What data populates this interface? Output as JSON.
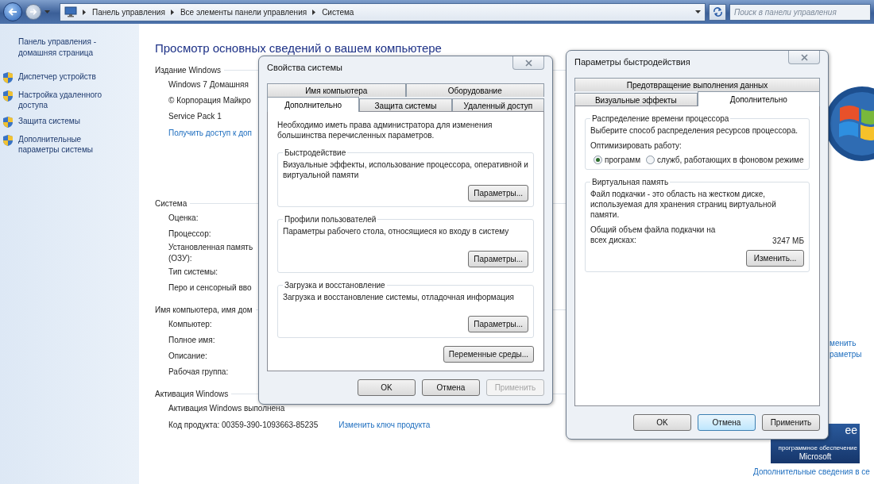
{
  "address_bar": {
    "breadcrumbs": [
      "Панель управления",
      "Все элементы панели управления",
      "Система"
    ],
    "search": {
      "placeholder": "Поиск в панели управления"
    }
  },
  "sidebar": {
    "home_link": "Панель управления - домашняя страница",
    "items": [
      {
        "label": "Диспетчер устройств"
      },
      {
        "label": "Настройка удаленного доступа"
      },
      {
        "label": "Защита системы"
      },
      {
        "label": "Дополнительные параметры системы"
      }
    ]
  },
  "main": {
    "title": "Просмотр основных сведений о вашем компьютере",
    "sections": [
      {
        "heading": "Издание Windows",
        "rows": [
          {
            "label": "Windows 7 Домашняя",
            "kind": "text"
          },
          {
            "label": "© Корпорация Майкро",
            "kind": "text"
          },
          {
            "label": "Service Pack 1",
            "kind": "text"
          },
          {
            "label": "Получить доступ к доп",
            "kind": "link"
          }
        ]
      },
      {
        "heading": "Система",
        "rows": [
          {
            "label": "Оценка:",
            "kind": "text"
          },
          {
            "label": "Процессор:",
            "kind": "text"
          },
          {
            "label": "Установленная память (ОЗУ):",
            "kind": "text"
          },
          {
            "label": "Тип системы:",
            "kind": "text"
          },
          {
            "label": "Перо и сенсорный вво",
            "kind": "text"
          }
        ]
      },
      {
        "heading": "Имя компьютера, имя дом",
        "rows": [
          {
            "label": "Компьютер:",
            "kind": "text"
          },
          {
            "label": "Полное имя:",
            "kind": "text"
          },
          {
            "label": "Описание:",
            "kind": "text"
          },
          {
            "label": "Рабочая группа:",
            "kind": "text"
          }
        ]
      },
      {
        "heading": "Активация Windows",
        "rows": [
          {
            "label": "Активация Windows выполнена",
            "kind": "text"
          },
          {
            "label": "Код продукта: 00359-390-1093663-85235",
            "kind": "text",
            "link": "Изменить ключ продукта"
          }
        ]
      }
    ],
    "side_link_lines": [
      "менить",
      "раметры"
    ],
    "badge": {
      "title": "ee",
      "subtitle": "программное обеспечение",
      "brand": "Microsoft"
    },
    "footer_link": "Дополнительные сведения в се"
  },
  "dialogs": [
    {
      "title": "Свойства системы",
      "tab_rows": [
        [
          {
            "label": "Имя компьютера",
            "selected": false
          },
          {
            "label": "Оборудование",
            "selected": false
          }
        ],
        [
          {
            "label": "Дополнительно",
            "selected": true
          },
          {
            "label": "Защита системы",
            "selected": false
          },
          {
            "label": "Удаленный доступ",
            "selected": false
          }
        ]
      ],
      "content": [
        {
          "kind": "note",
          "text": "Необходимо иметь права администратора для изменения большинства перечисленных параметров."
        },
        {
          "kind": "group",
          "title": "Быстродействие",
          "items": [
            {
              "kind": "text",
              "text": "Визуальные эффекты, использование процессора, оперативной и виртуальной памяти"
            },
            {
              "kind": "button",
              "label": "Параметры..."
            }
          ]
        },
        {
          "kind": "group",
          "title": "Профили пользователей",
          "items": [
            {
              "kind": "text",
              "text": "Параметры рабочего стола, относящиеся ко входу в систему"
            },
            {
              "kind": "button",
              "label": "Параметры..."
            }
          ]
        },
        {
          "kind": "group",
          "title": "Загрузка и восстановление",
          "items": [
            {
              "kind": "text",
              "text": "Загрузка и восстановление системы, отладочная информация"
            },
            {
              "kind": "button",
              "label": "Параметры..."
            }
          ]
        },
        {
          "kind": "button",
          "label": "Переменные среды..."
        }
      ],
      "buttons": [
        {
          "label": "OK",
          "disabled": false,
          "highlighted": false
        },
        {
          "label": "Отмена",
          "disabled": false,
          "highlighted": false
        },
        {
          "label": "Применить",
          "disabled": true,
          "highlighted": false
        }
      ]
    },
    {
      "title": "Параметры быстродействия",
      "tab_rows": [
        [
          {
            "label": "Предотвращение выполнения данных",
            "selected": false
          }
        ],
        [
          {
            "label": "Визуальные эффекты",
            "selected": false
          },
          {
            "label": "Дополнительно",
            "selected": true
          }
        ]
      ],
      "content": [
        {
          "kind": "group",
          "title": "Распределение времени процессора",
          "items": [
            {
              "kind": "text",
              "text": "Выберите способ распределения ресурсов процессора."
            },
            {
              "kind": "text",
              "text": "Оптимизировать работу:"
            },
            {
              "kind": "radios",
              "options": [
                {
                  "label": "программ",
                  "selected": true
                },
                {
                  "label": "служб, работающих в фоновом режиме",
                  "selected": false
                }
              ]
            }
          ]
        },
        {
          "kind": "group",
          "title": "Виртуальная память",
          "items": [
            {
              "kind": "text",
              "text": "Файл подкачки - это область на жестком диске, используемая для хранения страниц виртуальной памяти."
            },
            {
              "kind": "value",
              "label": "Общий объем файла подкачки на всех дисках:",
              "value": "3247 МБ"
            },
            {
              "kind": "button",
              "label": "Изменить..."
            }
          ]
        }
      ],
      "buttons": [
        {
          "label": "OK",
          "disabled": false,
          "highlighted": false
        },
        {
          "label": "Отмена",
          "disabled": false,
          "highlighted": true
        },
        {
          "label": "Применить",
          "disabled": false,
          "highlighted": false
        }
      ]
    }
  ]
}
